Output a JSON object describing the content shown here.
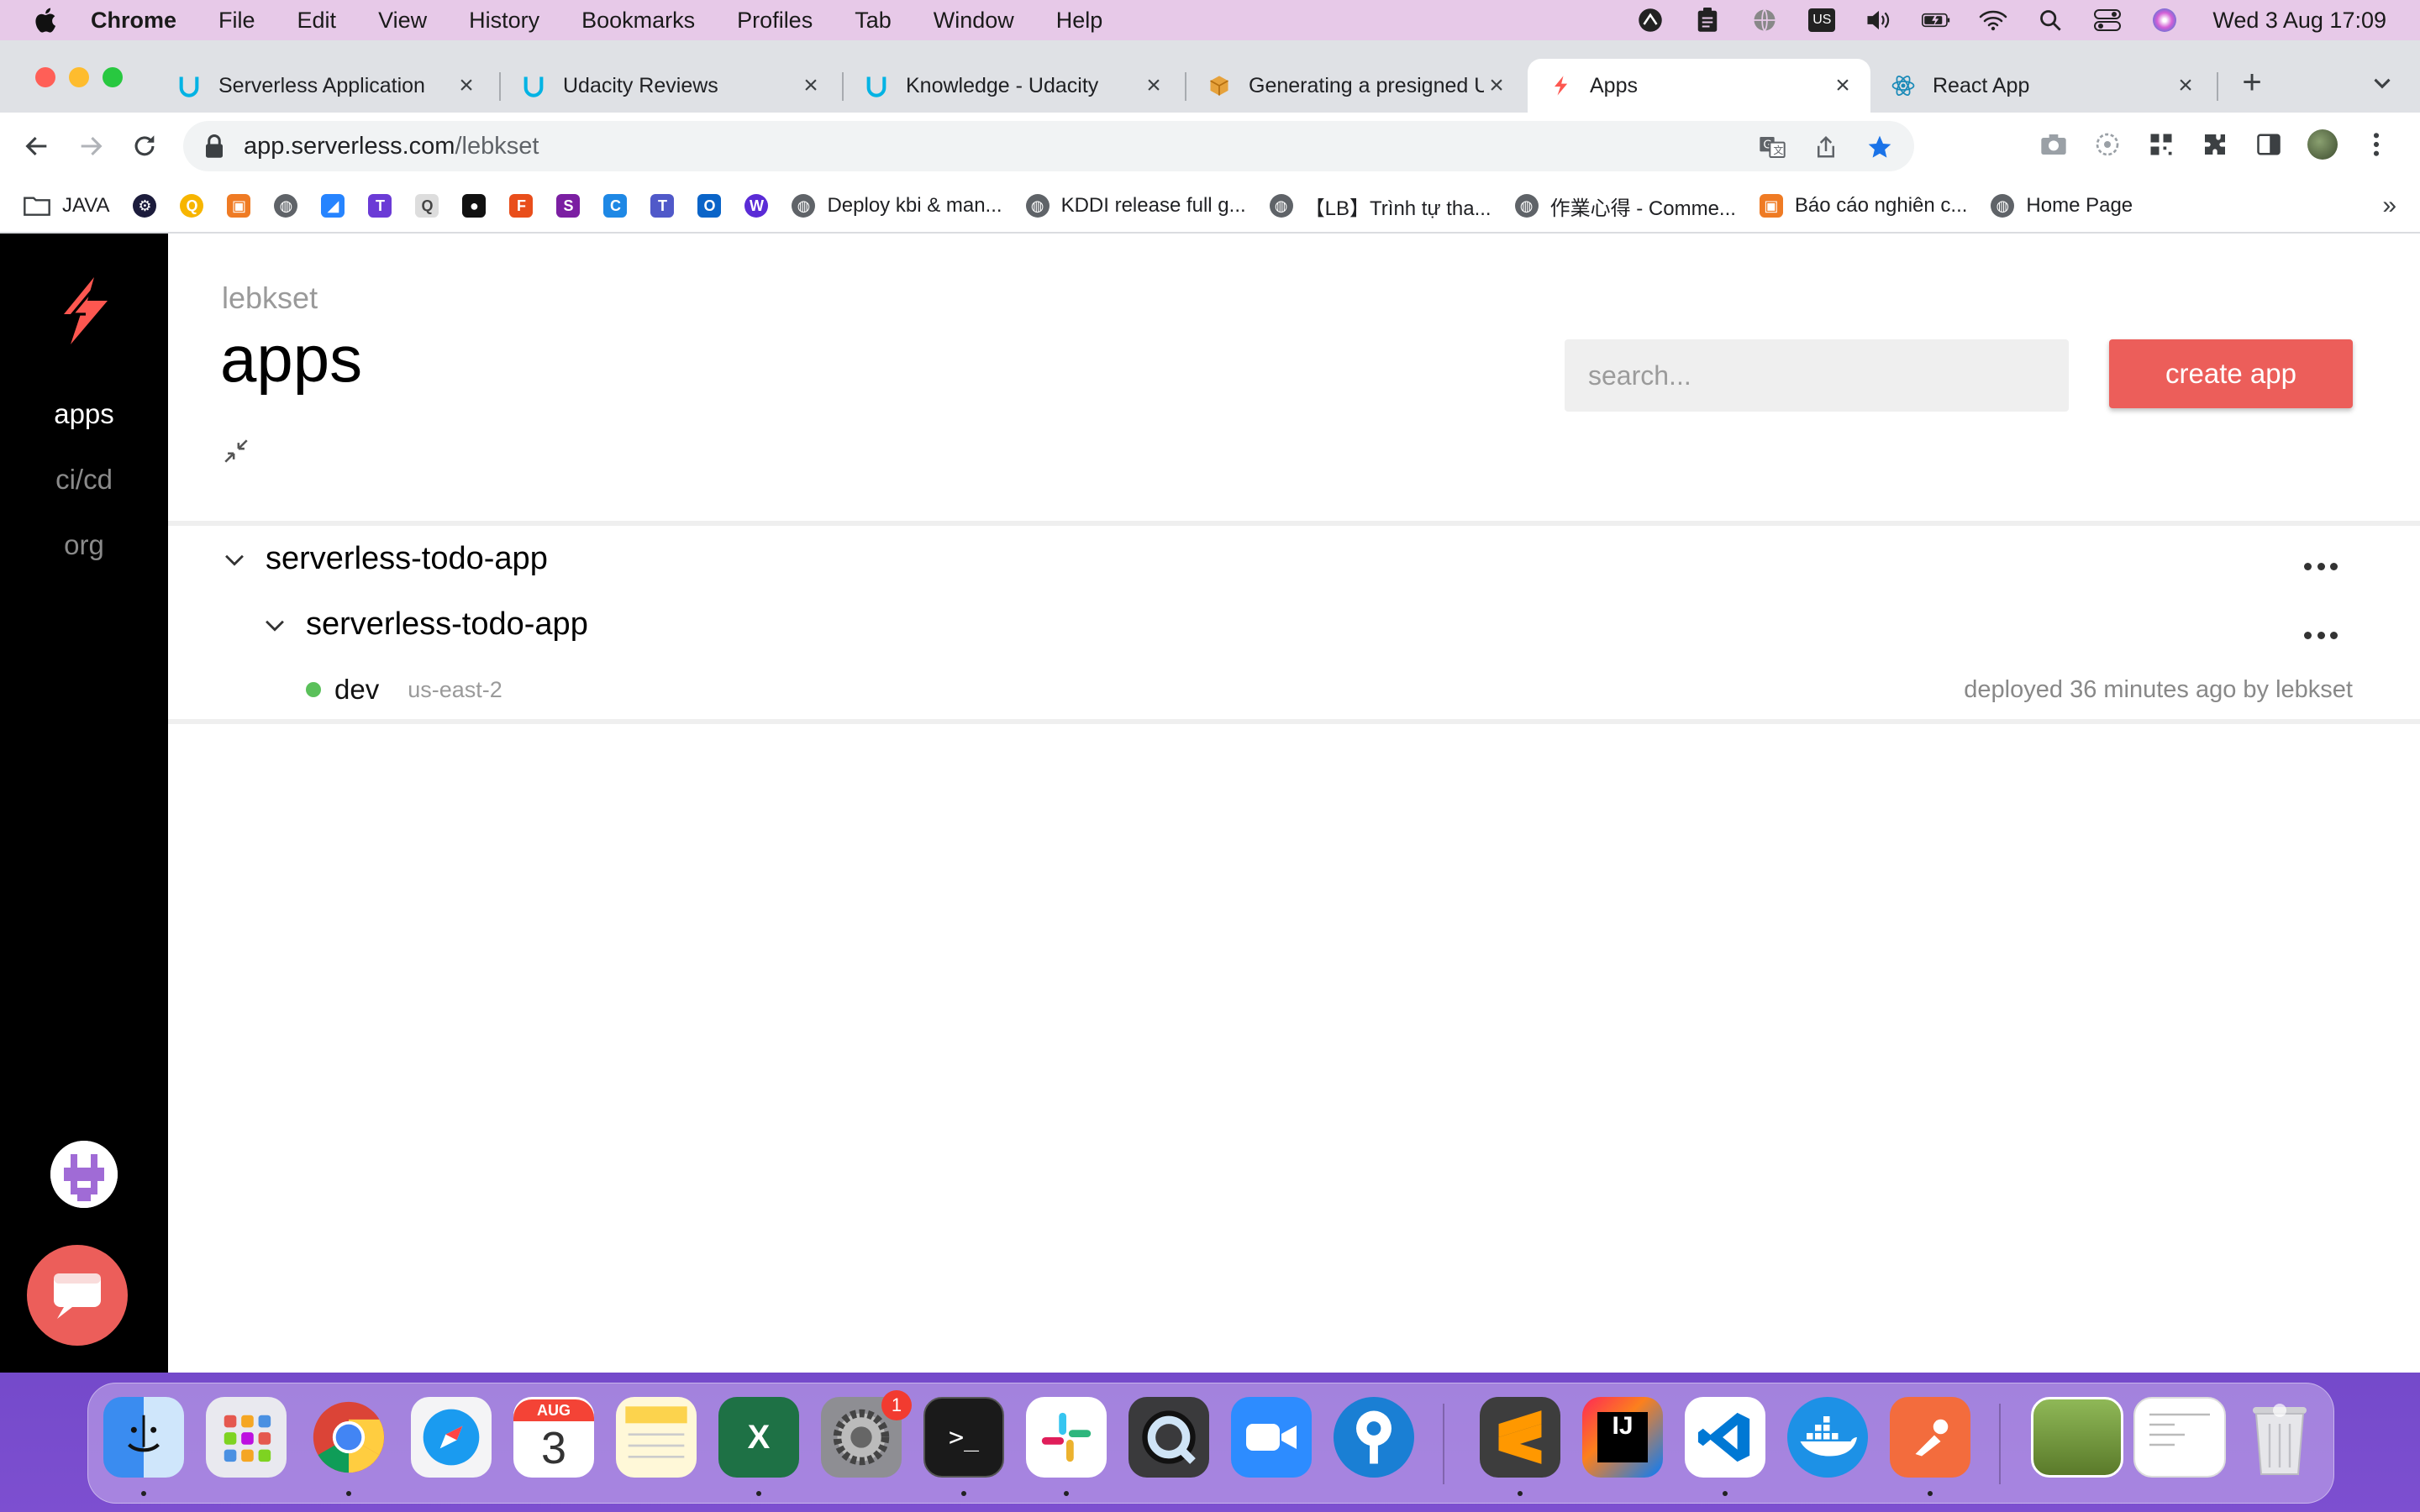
{
  "menubar": {
    "items": [
      "Chrome",
      "File",
      "Edit",
      "View",
      "History",
      "Bookmarks",
      "Profiles",
      "Tab",
      "Window",
      "Help"
    ],
    "input_source": "US",
    "clock": "Wed 3 Aug  17:09"
  },
  "browser": {
    "tabs": [
      {
        "title": "Serverless Application",
        "icon": "udacity-icon"
      },
      {
        "title": "Udacity Reviews",
        "icon": "udacity-icon"
      },
      {
        "title": "Knowledge - Udacity",
        "icon": "udacity-icon"
      },
      {
        "title": "Generating a presigned U",
        "icon": "aws-icon"
      },
      {
        "title": "Apps",
        "icon": "serverless-icon",
        "active": true
      },
      {
        "title": "React App",
        "icon": "react-icon"
      }
    ],
    "url_host": "app.serverless.com",
    "url_path": "/lebkset",
    "bookmarks": [
      {
        "label": "JAVA",
        "icon": "folder-icon"
      },
      {
        "label": "",
        "icon": "site-icon"
      },
      {
        "label": "",
        "icon": "site-icon"
      },
      {
        "label": "",
        "icon": "site-icon"
      },
      {
        "label": "",
        "icon": "globe-icon"
      },
      {
        "label": "",
        "icon": "site-icon"
      },
      {
        "label": "",
        "icon": "site-icon"
      },
      {
        "label": "",
        "icon": "site-icon"
      },
      {
        "label": "",
        "icon": "github-icon"
      },
      {
        "label": "",
        "icon": "site-icon"
      },
      {
        "label": "",
        "icon": "site-icon"
      },
      {
        "label": "",
        "icon": "site-icon"
      },
      {
        "label": "",
        "icon": "site-icon"
      },
      {
        "label": "",
        "icon": "site-icon"
      },
      {
        "label": "",
        "icon": "site-icon"
      },
      {
        "label": "Deploy kbi & man...",
        "icon": "globe-icon"
      },
      {
        "label": "KDDI release full g...",
        "icon": "globe-icon"
      },
      {
        "label": "【LB】Trình tự tha...",
        "icon": "globe-icon"
      },
      {
        "label": "作業心得 - Comme...",
        "icon": "globe-icon"
      },
      {
        "label": "Báo cáo nghiên c...",
        "icon": "aws-icon"
      },
      {
        "label": "Home Page",
        "icon": "globe-icon"
      }
    ],
    "bookmarks_overflow": "»"
  },
  "sidebar": {
    "links": [
      {
        "label": "apps",
        "active": true
      },
      {
        "label": "ci/cd",
        "active": false
      },
      {
        "label": "org",
        "active": false
      }
    ]
  },
  "main": {
    "org": "lebkset",
    "title": "apps",
    "search_placeholder": "search...",
    "create_label": "create app",
    "app": {
      "name": "serverless-todo-app",
      "service": {
        "name": "serverless-todo-app",
        "instance": {
          "stage": "dev",
          "region": "us-east-2",
          "status_color": "#5ac05a",
          "deployed": "deployed 36 minutes ago by lebkset"
        }
      }
    }
  },
  "colors": {
    "accent": "#ec5e5a",
    "sidebar": "#000000",
    "status_ok": "#5ac05a"
  },
  "dock": {
    "calendar_month": "AUG",
    "calendar_day": "3",
    "settings_badge": "1"
  }
}
